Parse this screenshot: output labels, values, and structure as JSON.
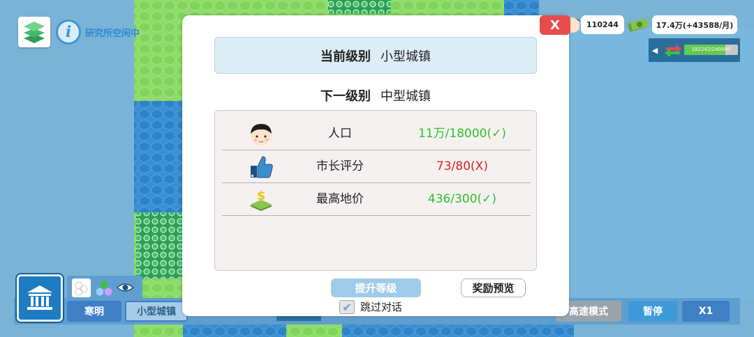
{
  "hud": {
    "lab_status": "研究所空闲中",
    "info_icon": "i",
    "population": "110244",
    "money": "17.4万(+43588/月)",
    "trade_text": "182242/240000",
    "trade_progress": 0.76
  },
  "modal": {
    "close_label": "X",
    "current_level_label": "当前级别",
    "current_level_value": "小型城镇",
    "next_level_label": "下一级别",
    "next_level_value": "中型城镇",
    "requirements": [
      {
        "icon": "person-face-icon",
        "name": "人口",
        "value": "11万/18000(✓)",
        "met": true
      },
      {
        "icon": "thumbs-up-icon",
        "name": "市长评分",
        "value": "73/80(X)",
        "met": false
      },
      {
        "icon": "land-price-icon",
        "name": "最高地价",
        "value": "436/300(✓)",
        "met": true
      }
    ],
    "upgrade_button": "提升等级",
    "reward_button": "奖励预览",
    "skip_dialog_label": "跳过对话",
    "skip_dialog_checked": true
  },
  "bottom": {
    "era_label": "寒明",
    "town_label": "小型城镇",
    "speed_mode_label": "高速模式",
    "pause_label": "暂停",
    "speed_label": "X1"
  },
  "colors": {
    "met": "#2bc12b",
    "unmet": "#e02020",
    "land": "#7dd65c",
    "water": "#2d83c9"
  }
}
